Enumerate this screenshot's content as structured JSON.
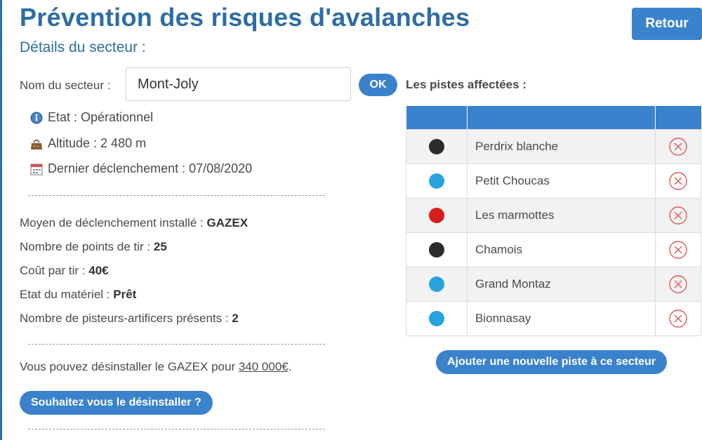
{
  "header": {
    "title": "Prévention des risques d'avalanches",
    "subtitle": "Détails du secteur :",
    "back_label": "Retour"
  },
  "sector": {
    "name_label": "Nom du secteur :",
    "name_value": "Mont-Joly",
    "ok_label": "OK",
    "etat": "Etat : Opérationnel",
    "altitude": "Altitude : 2 480 m",
    "dernier": "Dernier déclenchement : 07/08/2020"
  },
  "details": [
    {
      "label": "Moyen de déclenchement installé : ",
      "value": "GAZEX"
    },
    {
      "label": "Nombre de points de tir : ",
      "value": "25"
    },
    {
      "label": "Coût par tir : ",
      "value": "40€"
    },
    {
      "label": "Etat du matériel : ",
      "value": "Prêt"
    },
    {
      "label": "Nombre de pisteurs-artificers présents : ",
      "value": "2"
    }
  ],
  "uninstall": {
    "text_prefix": "Vous pouvez désinstaller le GAZEX pour ",
    "price": "340 000€",
    "text_suffix": ".",
    "button_label": "Souhaitez vous le désinstaller ?"
  },
  "pistes": {
    "title": "Les pistes affectées :",
    "add_label": "Ajouter une nouvelle piste à ce secteur",
    "rows": [
      {
        "name": "Perdrix blanche",
        "color": "#2b2b2b"
      },
      {
        "name": "Petit Choucas",
        "color": "#29a3e0"
      },
      {
        "name": "Les marmottes",
        "color": "#d91c1c"
      },
      {
        "name": "Chamois",
        "color": "#2b2b2b"
      },
      {
        "name": "Grand Montaz",
        "color": "#29a3e0"
      },
      {
        "name": "Bionnasay",
        "color": "#29a3e0"
      }
    ]
  },
  "colors": {
    "accent": "#3b82cc",
    "title": "#2e6da4",
    "delete": "#e05a5a"
  }
}
